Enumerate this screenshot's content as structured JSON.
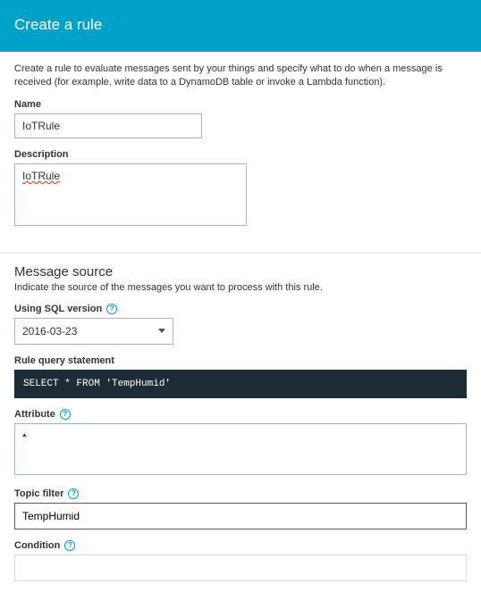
{
  "header": {
    "title": "Create a rule"
  },
  "intro": "Create a rule to evaluate messages sent by your things and specify what to do when a message is received (for example, write data to a DynamoDB table or invoke a Lambda function).",
  "fields": {
    "name": {
      "label": "Name",
      "value": "IoTRule"
    },
    "description": {
      "label": "Description",
      "value": "IoTRule"
    }
  },
  "messageSource": {
    "heading": "Message source",
    "desc": "Indicate the source of the messages you want to process with this rule.",
    "sqlVersion": {
      "label": "Using SQL version",
      "value": "2016-03-23"
    },
    "ruleQuery": {
      "label": "Rule query statement",
      "code": "SELECT * FROM 'TempHumid'"
    },
    "attribute": {
      "label": "Attribute",
      "value": "*"
    },
    "topicFilter": {
      "label": "Topic filter",
      "value": "TempHumid"
    },
    "condition": {
      "label": "Condition",
      "value": ""
    }
  }
}
